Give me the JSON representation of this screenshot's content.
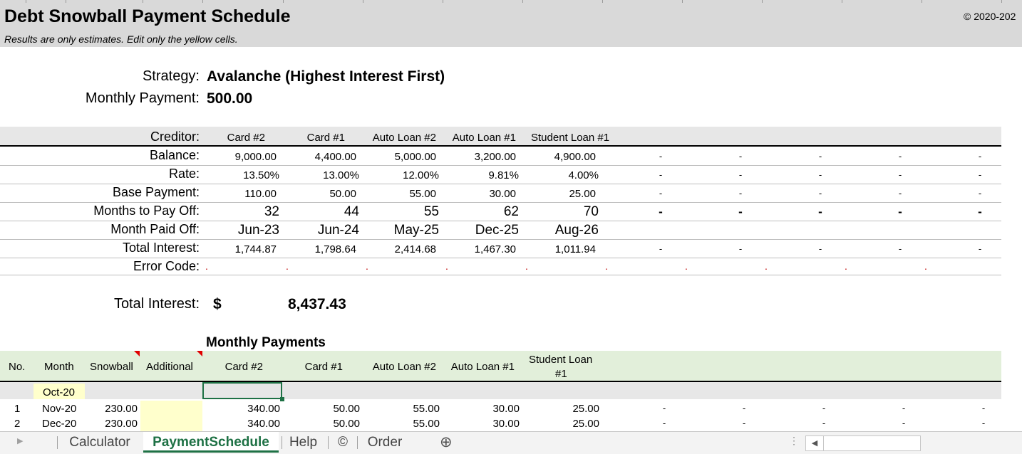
{
  "header": {
    "title": "Debt Snowball Payment Schedule",
    "subtitle": "Results are only estimates. Edit only the yellow cells.",
    "copyright": "© 2020-202"
  },
  "summary": {
    "strategy_label": "Strategy:",
    "strategy_value": "Avalanche (Highest Interest First)",
    "payment_label": "Monthly Payment:",
    "payment_value": "500.00",
    "total_interest_label": "Total Interest:",
    "currency": "$",
    "total_interest_value": "8,437.43"
  },
  "creditor_table": {
    "labels": [
      "Creditor:",
      "Balance:",
      "Rate:",
      "Base Payment:",
      "Months to Pay Off:",
      "Month Paid Off:",
      "Total Interest:",
      "Error Code:"
    ],
    "creditors": [
      "Card #2",
      "Card #1",
      "Auto Loan #2",
      "Auto Loan #1",
      "Student Loan #1"
    ],
    "balance": [
      "9,000.00",
      "4,400.00",
      "5,000.00",
      "3,200.00",
      "4,900.00"
    ],
    "rate": [
      "13.50%",
      "13.00%",
      "12.00%",
      "9.81%",
      "4.00%"
    ],
    "base_payment": [
      "110.00",
      "50.00",
      "55.00",
      "30.00",
      "25.00"
    ],
    "months_to_pay_off": [
      "32",
      "44",
      "55",
      "62",
      "70"
    ],
    "month_paid_off": [
      "Jun-23",
      "Jun-24",
      "May-25",
      "Dec-25",
      "Aug-26"
    ],
    "total_interest": [
      "1,744.87",
      "1,798.64",
      "2,414.68",
      "1,467.30",
      "1,011.94"
    ],
    "empty_marker": "-",
    "error_marker": "."
  },
  "monthly_payments": {
    "title": "Monthly Payments",
    "headers": {
      "no": "No.",
      "month": "Month",
      "snowball": "Snowball",
      "additional": "Additional",
      "creditors": [
        "Card #2",
        "Card #1",
        "Auto Loan #2",
        "Auto Loan #1"
      ],
      "student_line1": "Student Loan",
      "student_line2": "#1"
    },
    "start_month": "Oct-20",
    "rows": [
      {
        "no": "1",
        "month": "Nov-20",
        "snowball": "230.00",
        "payments": [
          "340.00",
          "50.00",
          "55.00",
          "30.00",
          "25.00"
        ]
      },
      {
        "no": "2",
        "month": "Dec-20",
        "snowball": "230.00",
        "payments": [
          "340.00",
          "50.00",
          "55.00",
          "30.00",
          "25.00"
        ]
      }
    ]
  },
  "colors": {
    "header_band": "#d9d9d9",
    "creditor_band": "#e7e7e7",
    "payments_header": "#e2efda",
    "input_yellow": "#ffffcc",
    "accent_green": "#1e7145",
    "error_red": "#c00000"
  },
  "tabs": {
    "items": [
      "Calculator",
      "PaymentSchedule",
      "Help",
      "©",
      "Order"
    ],
    "active": "PaymentSchedule",
    "add_icon": "⊕"
  }
}
